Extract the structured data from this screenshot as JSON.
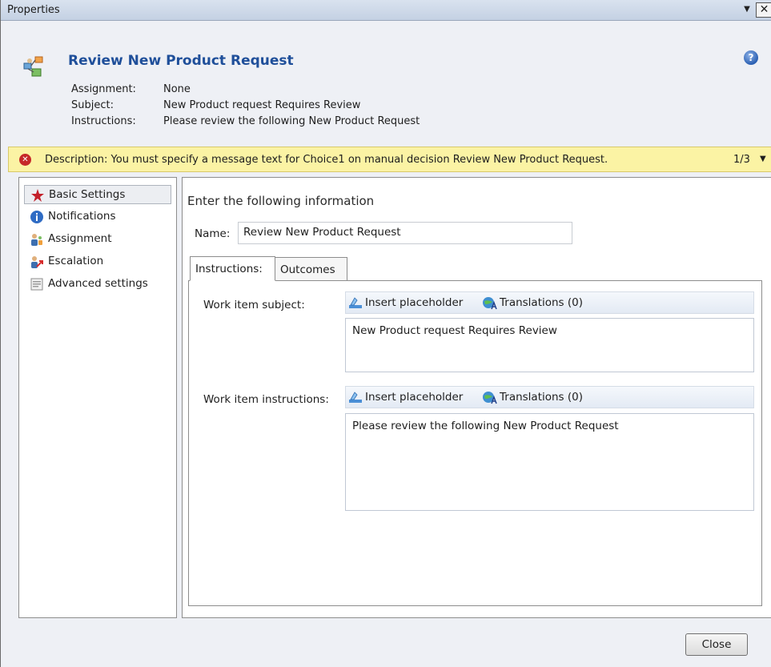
{
  "window": {
    "title": "Properties",
    "dropdown_glyph": "▼",
    "close_glyph": "✕"
  },
  "header": {
    "title": "Review New Product Request",
    "icon": "workflow-activity-icon",
    "help_glyph": "?",
    "fields": [
      {
        "label": "Assignment:",
        "value": "None"
      },
      {
        "label": "Subject:",
        "value": "New Product request Requires Review"
      },
      {
        "label": "Instructions:",
        "value": "Please review the following New Product Request"
      }
    ]
  },
  "warning": {
    "icon": "error-icon",
    "glyph": "✕",
    "text": "Description: You must specify a message text for Choice1 on manual decision Review New Product Request.",
    "counter": "1/3",
    "caret": "▼",
    "color": "#fbf3a4"
  },
  "nav": {
    "items": [
      {
        "label": "Basic Settings",
        "icon": "star-icon",
        "selected": true
      },
      {
        "label": "Notifications",
        "icon": "info-icon",
        "selected": false
      },
      {
        "label": "Assignment",
        "icon": "users-icon",
        "selected": false
      },
      {
        "label": "Escalation",
        "icon": "escalation-icon",
        "selected": false
      },
      {
        "label": "Advanced settings",
        "icon": "settings-page-icon",
        "selected": false
      }
    ]
  },
  "main": {
    "heading": "Enter the following information",
    "name_label": "Name:",
    "name_value": "Review New Product Request",
    "tabs": [
      {
        "label": "Instructions:",
        "active": true
      },
      {
        "label": "Outcomes",
        "active": false
      }
    ],
    "subject": {
      "label": "Work item subject:",
      "insert_placeholder": "Insert placeholder",
      "translations": "Translations (0)",
      "value": "New Product request Requires Review"
    },
    "instructions": {
      "label": "Work item instructions:",
      "insert_placeholder": "Insert placeholder",
      "translations": "Translations (0)",
      "value": "Please review the following New Product Request"
    }
  },
  "footer": {
    "close_label": "Close"
  }
}
